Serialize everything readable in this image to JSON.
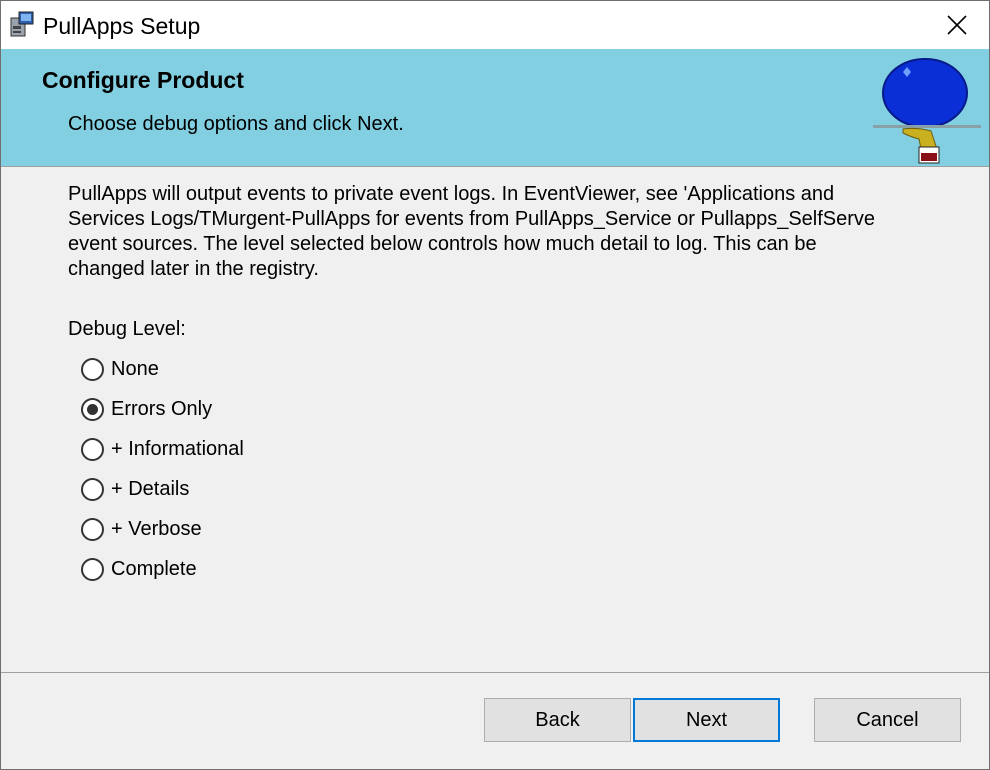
{
  "window": {
    "title": "PullApps Setup"
  },
  "banner": {
    "title": "Configure Product",
    "subtitle": "Choose debug options and click Next."
  },
  "description": "PullApps will output events to private event logs. In EventViewer, see 'Applications and Services Logs/TMurgent-PullApps for events from PullApps_Service or Pullapps_SelfServe event sources. The level selected below controls how much detail to log. This can be changed later in the registry.",
  "debug": {
    "label": "Debug Level:",
    "options": [
      {
        "label": "None",
        "checked": false
      },
      {
        "label": "Errors Only",
        "checked": true
      },
      {
        "label": "+ Informational",
        "checked": false
      },
      {
        "label": "+ Details",
        "checked": false
      },
      {
        "label": "+ Verbose",
        "checked": false
      },
      {
        "label": "Complete",
        "checked": false
      }
    ]
  },
  "buttons": {
    "back": "Back",
    "next": "Next",
    "cancel": "Cancel"
  },
  "icons": {
    "close": "close-icon",
    "app": "installer-app-icon",
    "logo": "pullapps-logo"
  },
  "colors": {
    "banner": "#81cfe0",
    "default_button_border": "#0078d7"
  }
}
